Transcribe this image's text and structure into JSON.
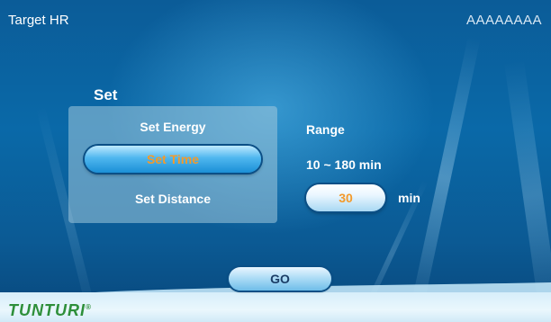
{
  "header": {
    "title": "Target HR",
    "user": "AAAAAAAA"
  },
  "set_panel": {
    "heading": "Set",
    "options": [
      {
        "label": "Set Energy",
        "selected": false
      },
      {
        "label": "Set Time",
        "selected": true
      },
      {
        "label": "Set Distance",
        "selected": false
      }
    ]
  },
  "range": {
    "label": "Range",
    "value": "10 ~ 180 min"
  },
  "value_input": {
    "value": "30",
    "unit": "min"
  },
  "go_button": {
    "label": "GO"
  },
  "footer": {
    "logo": "TUNTURI"
  },
  "colors": {
    "background": "#0a69a8",
    "accent_orange": "#f39a2c",
    "logo_green": "#2e8f3a"
  }
}
